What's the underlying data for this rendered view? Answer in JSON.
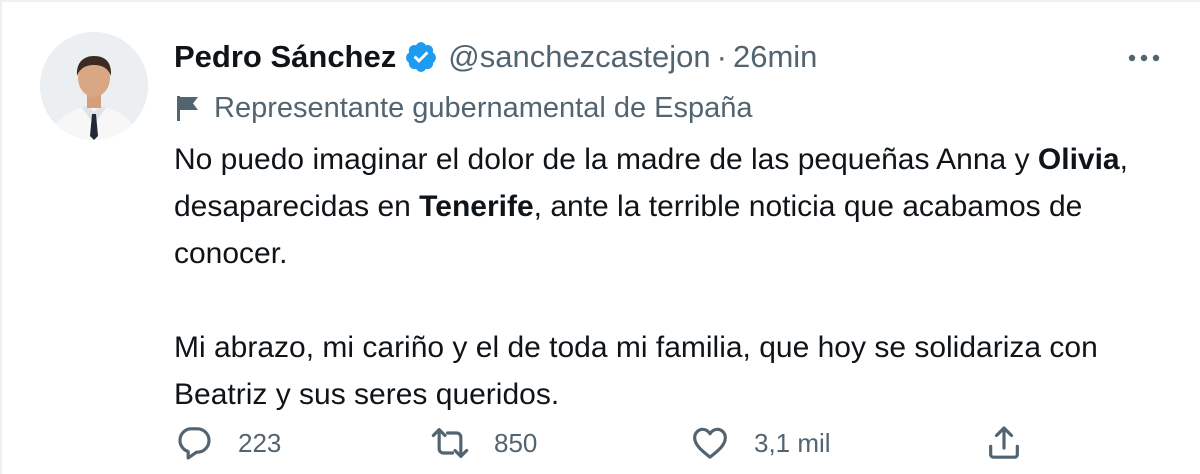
{
  "author": {
    "name": "Pedro Sánchez",
    "handle": "@sanchezcastejon",
    "separator": "·",
    "time": "26min",
    "label": "Representante gubernamental de España"
  },
  "tweet": {
    "p1_seg1": "No puedo imaginar el dolor de la madre de las pequeñas Anna y ",
    "p1_bold1": "Olivia",
    "p1_seg2": ", desaparecidas en ",
    "p1_bold2": "Tenerife",
    "p1_seg3": ", ante la terrible noticia que acabamos de conocer.",
    "p2": "Mi abrazo, mi cariño y el de toda mi familia, que hoy se solidariza con Beatriz y sus seres queridos."
  },
  "actions": {
    "replies": "223",
    "retweets": "850",
    "likes": "3,1 mil"
  },
  "icons": {
    "avatar": "avatar-photo",
    "verified": "verified-badge-icon",
    "more": "more-icon",
    "label": "flag-icon",
    "reply": "reply-icon",
    "retweet": "retweet-icon",
    "like": "like-icon",
    "share": "share-icon"
  },
  "colors": {
    "verified": "#1d9bf0",
    "secondary_text": "#536471",
    "primary_text": "#0f1419"
  }
}
